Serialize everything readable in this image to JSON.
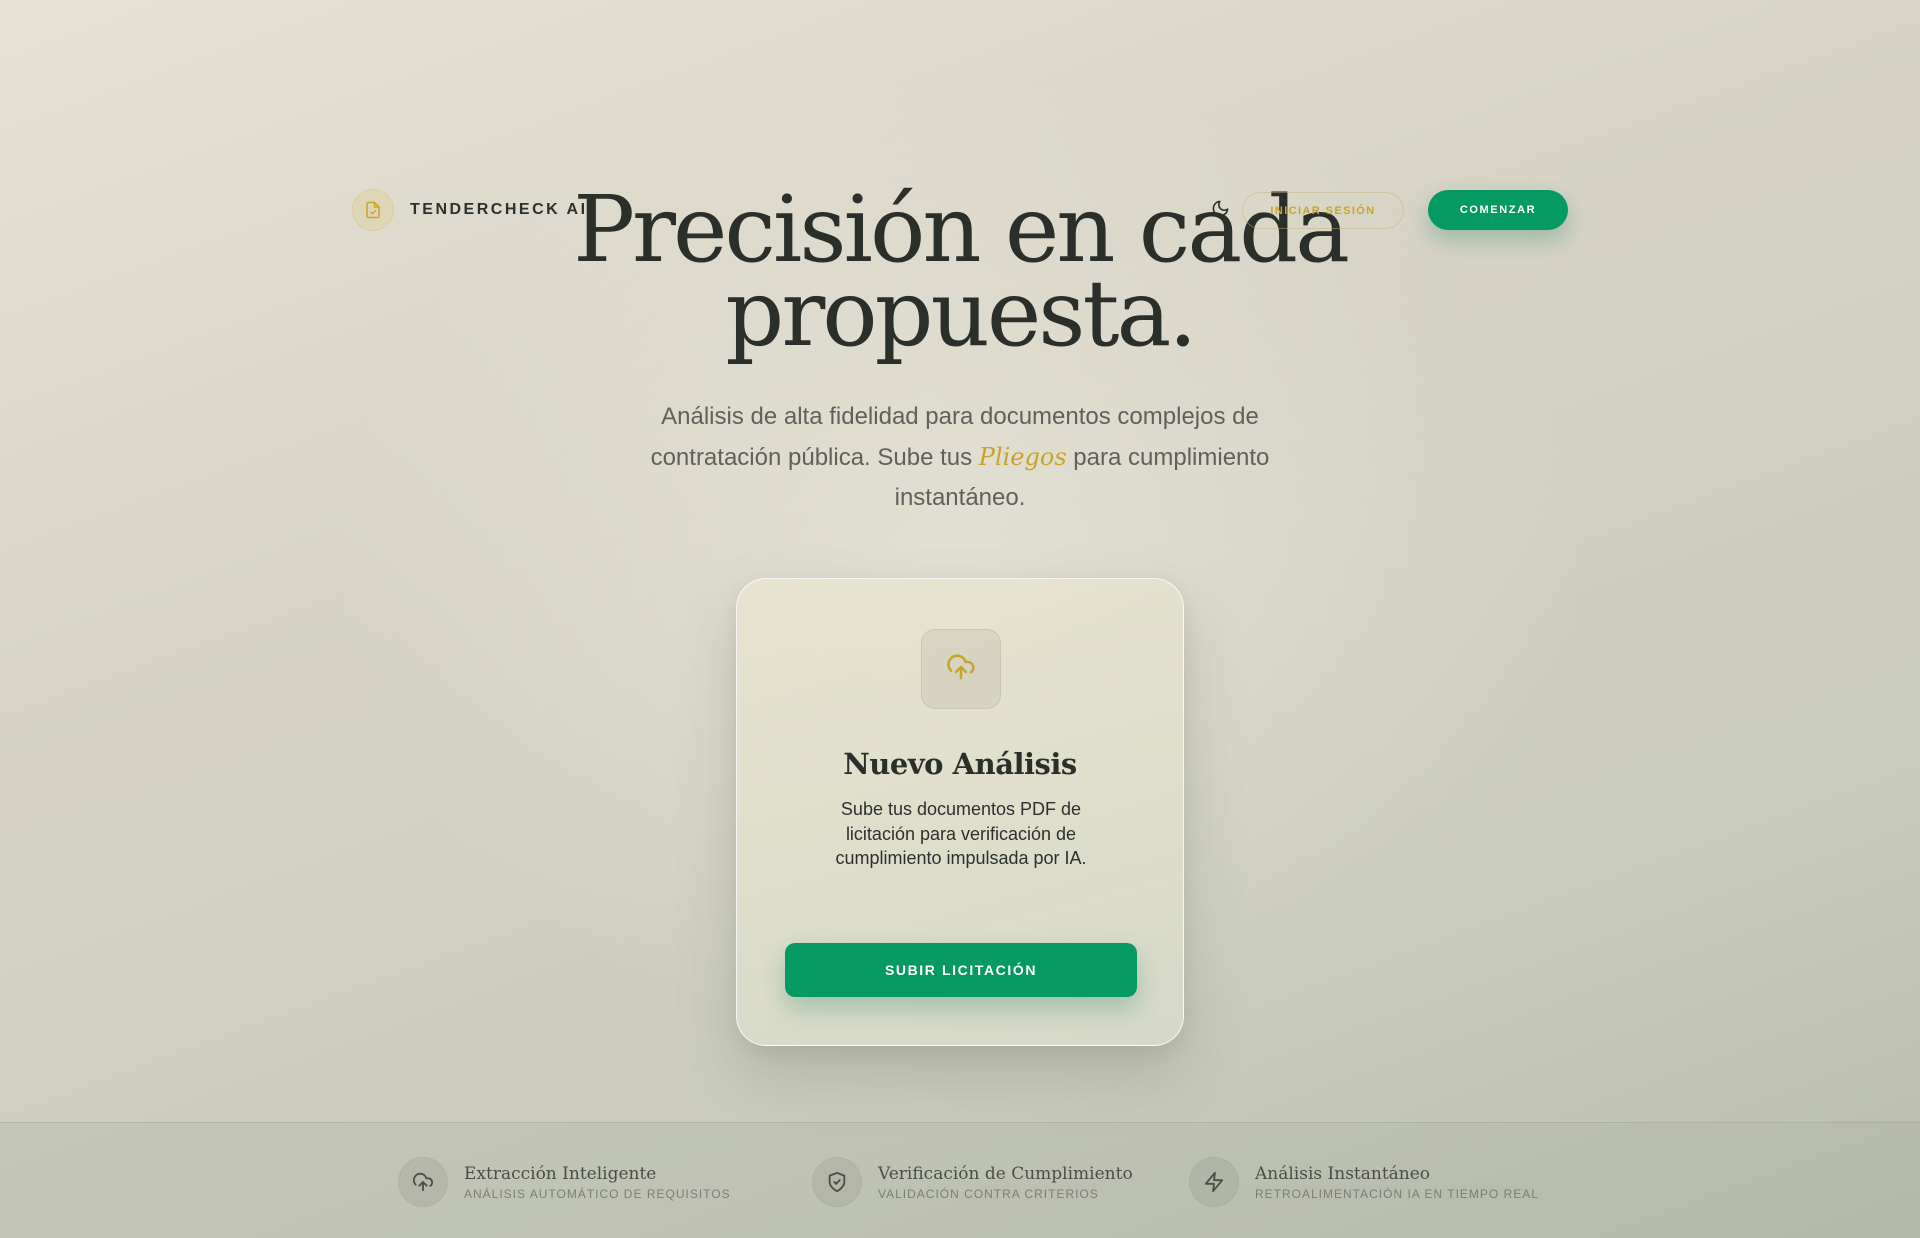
{
  "header": {
    "brand_name": "TENDERCHECK AI",
    "brand_icon": "file-check-icon",
    "theme_toggle_icon": "moon-icon",
    "login_label": "INICIAR SESIÓN",
    "start_label": "COMENZAR"
  },
  "hero": {
    "title_line1": "Precisión en cada",
    "title_line2": "propuesta.",
    "subtitle_before": "Análisis de alta fidelidad para documentos complejos de contratación pública. Sube tus ",
    "subtitle_accent": "Pliegos",
    "subtitle_after": " para cumplimiento instantáneo."
  },
  "card": {
    "icon": "cloud-upload-icon",
    "title": "Nuevo Análisis",
    "description": "Sube tus documentos PDF de licitación para verificación de cumplimiento impulsada por IA.",
    "button_label": "SUBIR LICITACIÓN"
  },
  "features": [
    {
      "icon": "cloud-upload-icon",
      "title": "Extracción Inteligente",
      "subtitle": "ANÁLISIS AUTOMÁTICO DE REQUISITOS"
    },
    {
      "icon": "shield-check-icon",
      "title": "Verificación de Cumplimiento",
      "subtitle": "VALIDACIÓN CONTRA CRITERIOS"
    },
    {
      "icon": "lightning-icon",
      "title": "Análisis Instantáneo",
      "subtitle": "RETROALIMENTACIÓN IA EN TIEMPO REAL"
    }
  ],
  "colors": {
    "accent_gold": "#c9a42c",
    "primary_green": "#069a63",
    "text_dark": "#2b2f2a"
  }
}
